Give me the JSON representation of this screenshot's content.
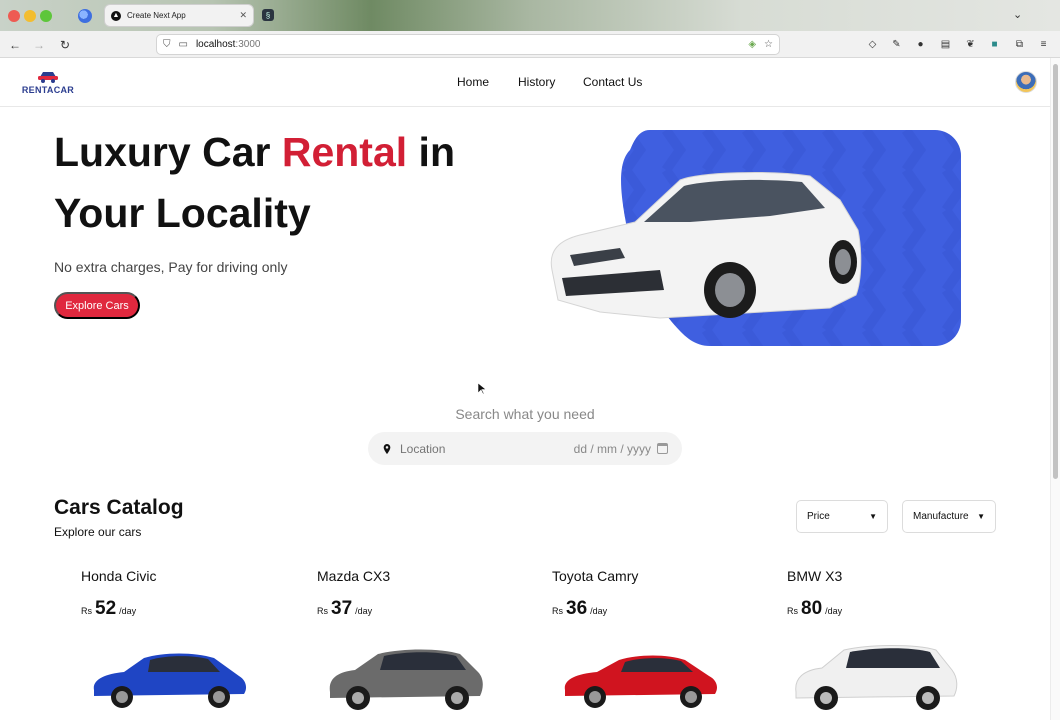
{
  "browser": {
    "tab_title": "Create Next App",
    "tab_favicon": "▲",
    "url_host": "localhost",
    "url_port": ":3000"
  },
  "header": {
    "logo_text": "RENTACAR",
    "menu": [
      {
        "label": "Home"
      },
      {
        "label": "History"
      },
      {
        "label": "Contact Us"
      }
    ]
  },
  "hero": {
    "title_part1": "Luxury Car ",
    "title_accent": "Rental",
    "title_part2": " in Your Locality",
    "subtitle": "No extra charges, Pay for driving only",
    "cta_label": "Explore Cars",
    "accent_color": "#d21f35",
    "panel_color": "#3f5fe0"
  },
  "search": {
    "heading": "Search what you need",
    "location_placeholder": "Location",
    "date_placeholder": "dd / mm / yyyy"
  },
  "catalog": {
    "title": "Cars Catalog",
    "subtitle": "Explore our cars",
    "filters": [
      {
        "label": "Price"
      },
      {
        "label": "Manufacturer"
      }
    ],
    "cars": [
      {
        "name": "Honda Civic",
        "currency": "Rs",
        "price": "52",
        "unit": "/day",
        "color": "#1f45c4"
      },
      {
        "name": "Mazda CX3",
        "currency": "Rs",
        "price": "37",
        "unit": "/day",
        "color": "#6b6b6b"
      },
      {
        "name": "Toyota Camry",
        "currency": "Rs",
        "price": "36",
        "unit": "/day",
        "color": "#d0141f"
      },
      {
        "name": "BMW X3",
        "currency": "Rs",
        "price": "80",
        "unit": "/day",
        "color": "#f0f0f0"
      }
    ]
  }
}
